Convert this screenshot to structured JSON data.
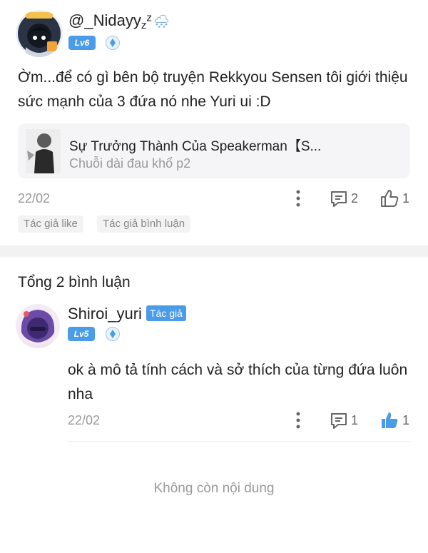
{
  "post": {
    "username": "@_Nidayy",
    "username_suffix": "z",
    "username_suffix_sup": "z",
    "weather_emoji": "🌨",
    "level": "Lv6",
    "text_line1": "Ờm...để có gì bên bộ truyện Rekkyou Sensen tôi giới thiệu",
    "text_line2": "sức mạnh của 3 đứa nó nhe Yuri ui :D",
    "card_title": "Sự Trưởng Thành Của Speakerman【S...",
    "card_subtitle": "Chuỗi dài đau khổ p2",
    "date": "22/02",
    "comment_count": "2",
    "like_count": "1",
    "tags": [
      "Tác giả like",
      "Tác giả bình luận"
    ]
  },
  "comments_section": {
    "total_label": "Tổng 2 bình luận"
  },
  "comment": {
    "username": "Shiroi_yuri",
    "author_tag": "Tác giả",
    "level": "Lv5",
    "text_line1": "ok à mô tả tính cách và sở thích của từng đứa luôn",
    "text_line2": "nha",
    "date": "22/02",
    "comment_count": "1",
    "like_count": "1"
  },
  "footer": {
    "end_label": "Không còn nội dung"
  },
  "colors": {
    "accent": "#4a9be8",
    "text": "#222222",
    "muted": "#999999",
    "card_bg": "#f5f5f7"
  }
}
